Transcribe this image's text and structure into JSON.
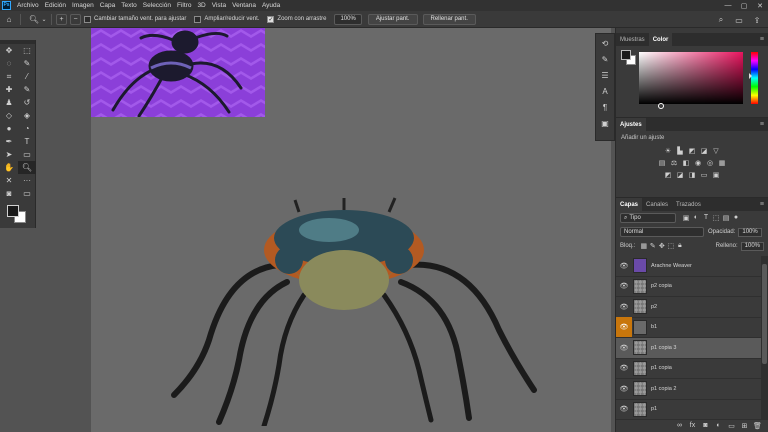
{
  "app": {
    "logo": "Ps"
  },
  "menu": [
    "Archivo",
    "Edición",
    "Imagen",
    "Capa",
    "Texto",
    "Selección",
    "Filtro",
    "3D",
    "Vista",
    "Ventana",
    "Ayuda"
  ],
  "window_controls": [
    "minimize-icon",
    "maximize-icon",
    "close-icon"
  ],
  "options": {
    "resize_windows_label": "Cambiar tamaño vent. para ajustar",
    "resize_windows_checked": false,
    "zoom_all_label": "Ampliar/reducir vent.",
    "zoom_all_checked": false,
    "scrubby_zoom_label": "Zoom con arrastre",
    "scrubby_zoom_checked": true,
    "zoom_value": "100%",
    "fit_screen_label": "Ajustar pant.",
    "fill_screen_label": "Rellenar pant."
  },
  "toolbox": {
    "tools": [
      "move-icon",
      "marquee-icon",
      "lasso-icon",
      "quick-select-icon",
      "crop-icon",
      "eyedropper-icon",
      "healing-icon",
      "brush-icon",
      "stamp-icon",
      "history-brush-icon",
      "eraser-icon",
      "paint-bucket-icon",
      "blur-icon",
      "dodge-icon",
      "pen-icon",
      "type-icon",
      "path-select-icon",
      "shape-icon",
      "hand-icon",
      "zoom-icon",
      "edit-toolbar-icon",
      "more-icon",
      "quick-mask-icon",
      "screen-mode-icon"
    ],
    "active_tool": "zoom-icon",
    "foreground_color": "#1a1a1a",
    "background_color": "#ffffff"
  },
  "color_panel": {
    "tabs": [
      {
        "label": "Muestras",
        "active": false
      },
      {
        "label": "Color",
        "active": true
      }
    ],
    "hue_color": "#e8145e"
  },
  "adjust_panel": {
    "title": "Ajustes",
    "subtitle": "Añadir un ajuste"
  },
  "layers_panel": {
    "tabs": [
      {
        "label": "Capas",
        "active": true
      },
      {
        "label": "Canales",
        "active": false
      },
      {
        "label": "Trazados",
        "active": false
      }
    ],
    "filter_kind": "Tipo",
    "blend_mode": "Normal",
    "opacity_label": "Opacidad:",
    "opacity_value": "100%",
    "lock_label": "Bloq.:",
    "fill_label": "Relleno:",
    "fill_value": "100%",
    "layers": [
      {
        "name": "Arachne Weaver",
        "thumb": "image",
        "selected": false,
        "mask": false
      },
      {
        "name": "p2 copia",
        "thumb": "transparent",
        "selected": false,
        "mask": false
      },
      {
        "name": "p2",
        "thumb": "transparent",
        "selected": false,
        "mask": false
      },
      {
        "name": "b1",
        "thumb": "dark",
        "selected": false,
        "mask": true
      },
      {
        "name": "p1 copia 3",
        "thumb": "transparent",
        "selected": true,
        "mask": false
      },
      {
        "name": "p1 copia",
        "thumb": "transparent",
        "selected": false,
        "mask": false
      },
      {
        "name": "p1 copia 2",
        "thumb": "transparent",
        "selected": false,
        "mask": false
      },
      {
        "name": "p1",
        "thumb": "transparent",
        "selected": false,
        "mask": false
      }
    ]
  }
}
